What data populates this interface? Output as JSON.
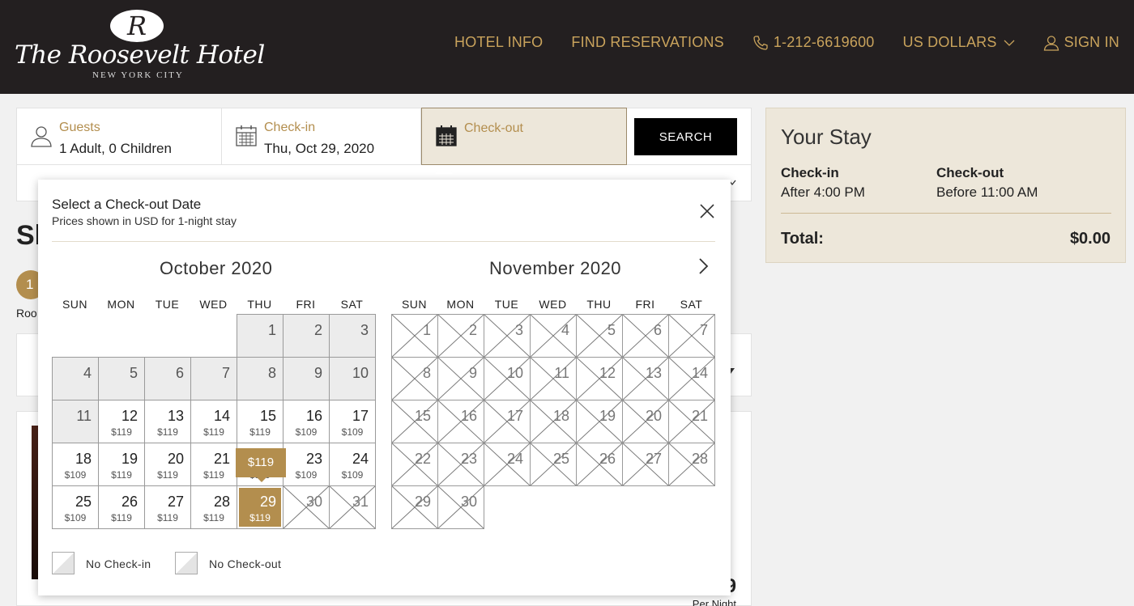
{
  "header": {
    "logo_letter": "R",
    "logo_name": "The Roosevelt Hotel",
    "logo_city": "NEW YORK CITY",
    "nav": {
      "hotel_info": "HOTEL INFO",
      "find_reservations": "FIND RESERVATIONS",
      "phone": "1-212-6619600",
      "currency": "US DOLLARS",
      "sign_in": "SIGN IN"
    }
  },
  "booking": {
    "guests_label": "Guests",
    "guests_value": "1 Adult, 0 Children",
    "checkin_label": "Check-in",
    "checkin_value": "Thu, Oct 29, 2020",
    "checkout_label": "Check-out",
    "checkout_value": "",
    "search_label": "SEARCH"
  },
  "background": {
    "heading_fragment": "Sl",
    "step_number": "1",
    "rooms_fragment": "Roo",
    "price_fragment": "9",
    "per_night_fragment": "Per Night"
  },
  "stay": {
    "title": "Your Stay",
    "checkin_head": "Check-in",
    "checkin_val": "After 4:00 PM",
    "checkout_head": "Check-out",
    "checkout_val": "Before 11:00 AM",
    "total_label": "Total:",
    "total_value": "$0.00"
  },
  "calendar": {
    "title": "Select a Check-out Date",
    "subtitle": "Prices shown in USD for 1-night stay",
    "days_of_week": [
      "SUN",
      "MON",
      "TUE",
      "WED",
      "THU",
      "FRI",
      "SAT"
    ],
    "tooltip": "$119",
    "months": [
      {
        "name": "October 2020",
        "first_weekday": 4,
        "days": [
          {
            "d": "1",
            "state": "past"
          },
          {
            "d": "2",
            "state": "past"
          },
          {
            "d": "3",
            "state": "past"
          },
          {
            "d": "4",
            "state": "past"
          },
          {
            "d": "5",
            "state": "past"
          },
          {
            "d": "6",
            "state": "past"
          },
          {
            "d": "7",
            "state": "past"
          },
          {
            "d": "8",
            "state": "past"
          },
          {
            "d": "9",
            "state": "past"
          },
          {
            "d": "10",
            "state": "past"
          },
          {
            "d": "11",
            "state": "past"
          },
          {
            "d": "12",
            "price": "$119"
          },
          {
            "d": "13",
            "price": "$119"
          },
          {
            "d": "14",
            "price": "$119"
          },
          {
            "d": "15",
            "price": "$119"
          },
          {
            "d": "16",
            "price": "$109"
          },
          {
            "d": "17",
            "price": "$109"
          },
          {
            "d": "18",
            "price": "$109"
          },
          {
            "d": "19",
            "price": "$119"
          },
          {
            "d": "20",
            "price": "$119"
          },
          {
            "d": "21",
            "price": "$119"
          },
          {
            "d": "22",
            "price": "$119"
          },
          {
            "d": "23",
            "price": "$109"
          },
          {
            "d": "24",
            "price": "$109"
          },
          {
            "d": "25",
            "price": "$109"
          },
          {
            "d": "26",
            "price": "$119"
          },
          {
            "d": "27",
            "price": "$119"
          },
          {
            "d": "28",
            "price": "$119"
          },
          {
            "d": "29",
            "price": "$119",
            "state": "selected"
          },
          {
            "d": "30",
            "state": "nocheck"
          },
          {
            "d": "31",
            "state": "nocheck"
          }
        ]
      },
      {
        "name": "November 2020",
        "first_weekday": 0,
        "days": [
          {
            "d": "1",
            "state": "nocheck"
          },
          {
            "d": "2",
            "state": "nocheck"
          },
          {
            "d": "3",
            "state": "nocheck"
          },
          {
            "d": "4",
            "state": "nocheck"
          },
          {
            "d": "5",
            "state": "nocheck"
          },
          {
            "d": "6",
            "state": "nocheck"
          },
          {
            "d": "7",
            "state": "nocheck"
          },
          {
            "d": "8",
            "state": "nocheck"
          },
          {
            "d": "9",
            "state": "nocheck"
          },
          {
            "d": "10",
            "state": "nocheck"
          },
          {
            "d": "11",
            "state": "nocheck"
          },
          {
            "d": "12",
            "state": "nocheck"
          },
          {
            "d": "13",
            "state": "nocheck"
          },
          {
            "d": "14",
            "state": "nocheck"
          },
          {
            "d": "15",
            "state": "nocheck"
          },
          {
            "d": "16",
            "state": "nocheck"
          },
          {
            "d": "17",
            "state": "nocheck"
          },
          {
            "d": "18",
            "state": "nocheck"
          },
          {
            "d": "19",
            "state": "nocheck"
          },
          {
            "d": "20",
            "state": "nocheck"
          },
          {
            "d": "21",
            "state": "nocheck"
          },
          {
            "d": "22",
            "state": "nocheck"
          },
          {
            "d": "23",
            "state": "nocheck"
          },
          {
            "d": "24",
            "state": "nocheck"
          },
          {
            "d": "25",
            "state": "nocheck"
          },
          {
            "d": "26",
            "state": "nocheck"
          },
          {
            "d": "27",
            "state": "nocheck"
          },
          {
            "d": "28",
            "state": "nocheck"
          },
          {
            "d": "29",
            "state": "nocheck"
          },
          {
            "d": "30",
            "state": "nocheck"
          }
        ]
      }
    ],
    "legend": {
      "no_checkin": "No Check-in",
      "no_checkout": "No Check-out"
    }
  },
  "colors": {
    "accent_gold": "#b38e4e",
    "nav_gold": "#c9a35c",
    "header_bg": "#231f20",
    "stay_bg": "#ede7da"
  }
}
